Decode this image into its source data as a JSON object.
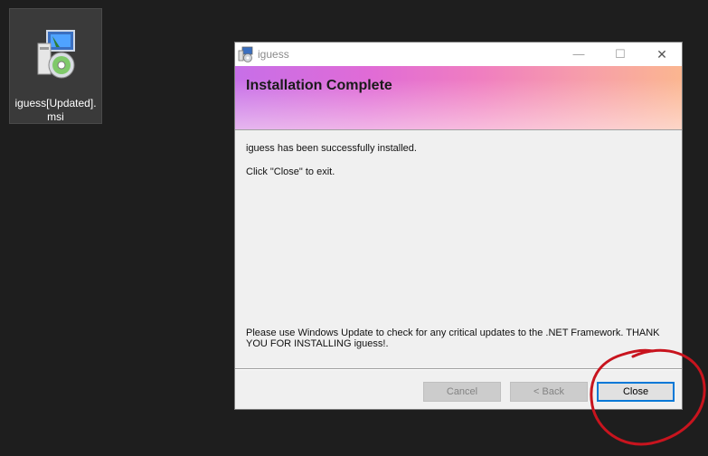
{
  "desktop": {
    "icon_name": "installer-package-icon",
    "file_label": "iguess[Updated].msi"
  },
  "window": {
    "title": "iguess",
    "controls": {
      "minimize": "—",
      "maximize": "☐",
      "close": "✕"
    },
    "banner_heading": "Installation Complete",
    "body": {
      "line1": "iguess has been successfully installed.",
      "line2": "Click \"Close\" to exit.",
      "line3": "Please use Windows Update to check for any critical updates to the .NET Framework. THANK YOU FOR INSTALLING iguess!."
    },
    "buttons": {
      "cancel": "Cancel",
      "back": "< Back",
      "close": "Close"
    }
  },
  "colors": {
    "desktop_bg": "#1e1e1e",
    "annotation_circle": "#c8141e",
    "focus_border": "#0078d7"
  }
}
